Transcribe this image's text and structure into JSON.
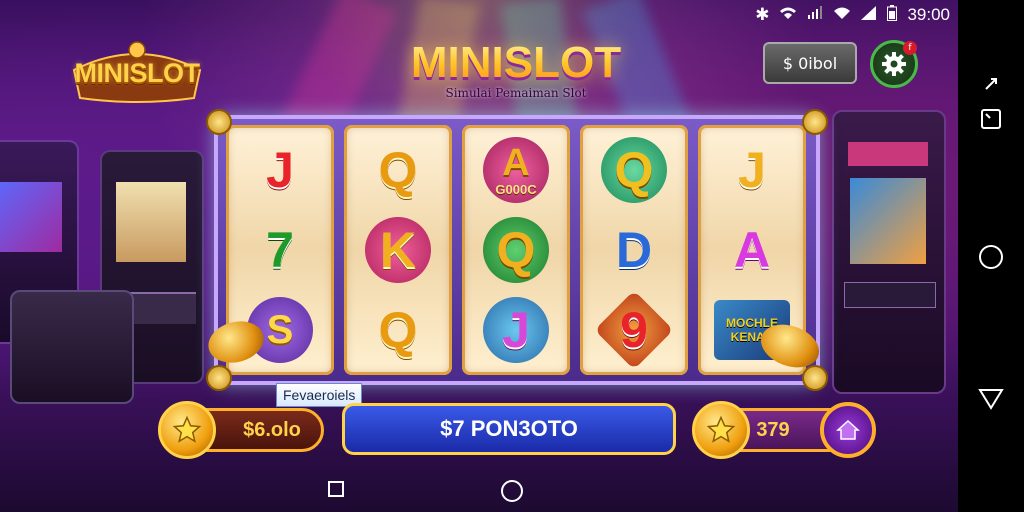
{
  "status_bar": {
    "time": "39:00",
    "icons": [
      "bluetooth-icon",
      "wifi-icon",
      "signal-icon",
      "wifi-alt-icon",
      "signal-full-icon",
      "battery-icon"
    ]
  },
  "header": {
    "logo_text": "MINISLOT",
    "title": "MINISLOT",
    "subtitle": "Simulai Pemaiman Slot",
    "balance_button": "$ 0ibol",
    "notification_count": "f"
  },
  "reels": [
    {
      "symbols": [
        {
          "text": "J",
          "color": "#e8242a"
        },
        {
          "text": "7",
          "color": "#1e9a2a"
        },
        {
          "text": "S",
          "color": "#ffd84a",
          "badge": "#7a3ac8"
        }
      ]
    },
    {
      "symbols": [
        {
          "text": "Q",
          "color": "#e89a10"
        },
        {
          "text": "K",
          "color": "#f0b020",
          "badge": "#e0408a"
        },
        {
          "text": "Q",
          "color": "#e89a10"
        }
      ]
    },
    {
      "symbols": [
        {
          "text": "A",
          "color": "#f0b020",
          "badge": "#e0408a",
          "caption": "G000C"
        },
        {
          "text": "Q",
          "color": "#e8a010",
          "badge": "#30a040"
        },
        {
          "text": "J",
          "color": "#c848c8",
          "badge": "#2a9ac8"
        }
      ]
    },
    {
      "symbols": [
        {
          "text": "Q",
          "color": "#f0c020",
          "badge": "#30a060"
        },
        {
          "text": "D",
          "color": "#2a6ad8"
        },
        {
          "text": "9",
          "color": "#e8242a",
          "badge": "#f08020"
        }
      ]
    },
    {
      "symbols": [
        {
          "text": "J",
          "color": "#f0b020"
        },
        {
          "text": "A",
          "color": "#d83ae0"
        },
        {
          "text": "MOCHLE KENAN",
          "color": "#f0d020",
          "badge": "#3a8ac8"
        }
      ]
    }
  ],
  "bottom": {
    "label": "Fevaeroiels",
    "credit": "$6.olo",
    "spin_button": "$7 PON3OTO",
    "bet": "379"
  },
  "colors": {
    "accent_gold": "#ffd24a",
    "spin_blue": "#2a4ad8",
    "bg_purple": "#4a1470"
  }
}
